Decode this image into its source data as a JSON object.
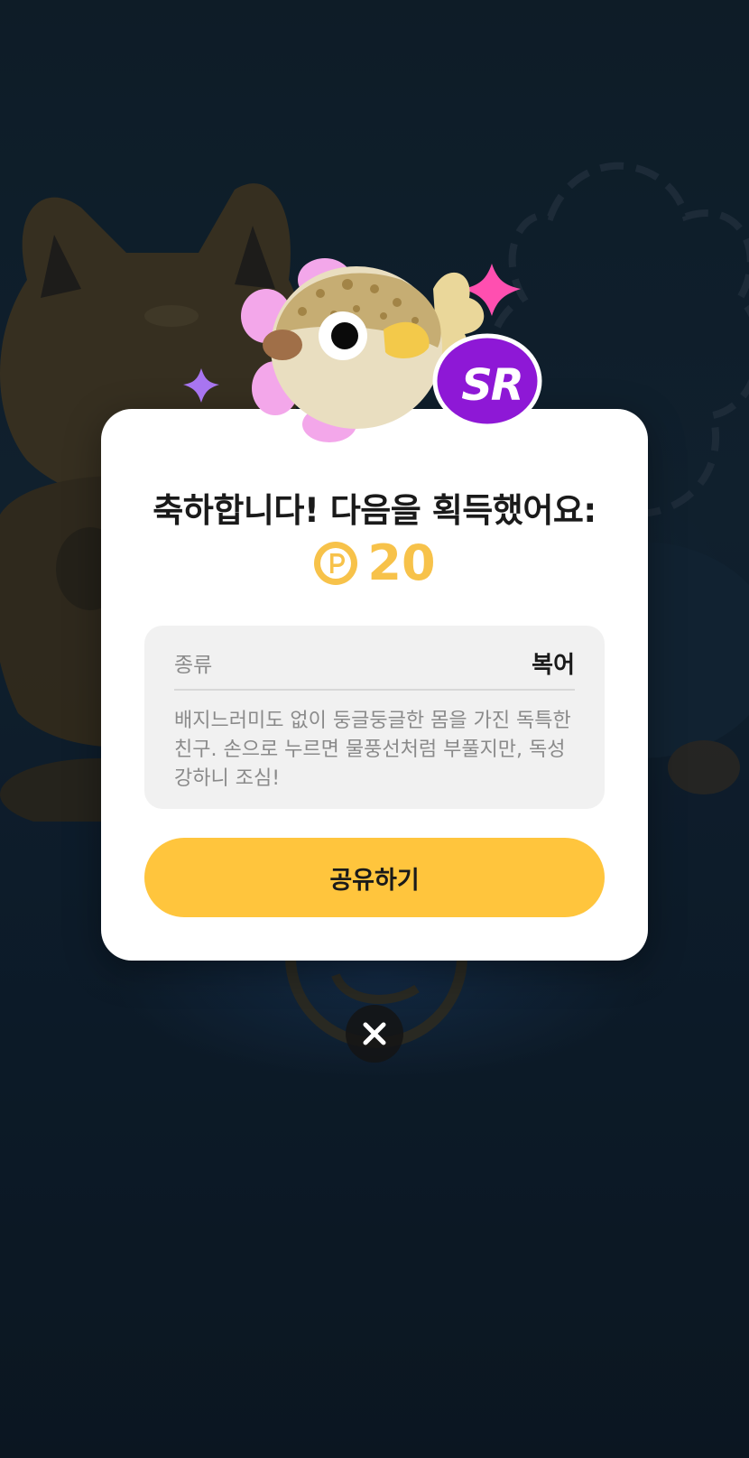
{
  "dialog": {
    "title": "축하합니다! 다음을 획득했어요:",
    "reward": {
      "icon": "point-coin-icon",
      "value": "20",
      "color": "#f7c24a"
    },
    "rarity_badge": "SR",
    "info": {
      "label": "종류",
      "value": "복어",
      "description": "배지느러미도 없이 둥글둥글한 몸을 가진 독특한 친구. 손으로 누르면 물풍선처럼 부풀지만, 독성 강하니 조심!"
    },
    "share_label": "공유하기",
    "close_icon": "close-icon"
  },
  "colors": {
    "accent": "#ffc53d",
    "badge": "#8e18d6",
    "background": "#0e1b28"
  }
}
